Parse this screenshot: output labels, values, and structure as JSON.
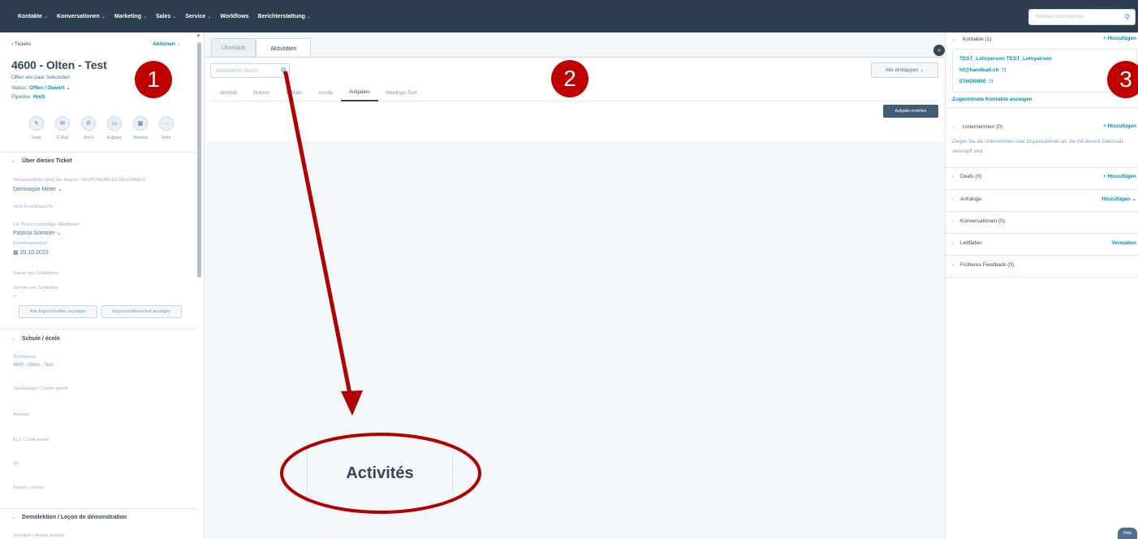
{
  "topnav": {
    "items": [
      "Kontakte",
      "Konversationen",
      "Marketing",
      "Sales",
      "Service",
      "Workflows",
      "Berichterstattung"
    ],
    "search_placeholder": "HubSpot durchsuchen"
  },
  "left": {
    "back_link": "Tickets",
    "actions_label": "Aktionen",
    "ticket_title": "4600 - Olten - Test",
    "opened": "Offen ein paar Sekunden",
    "status_label": "Status:",
    "status_value": "Offen / Ouvert",
    "pipeline_label": "Pipeline:",
    "pipeline_value": "HmS",
    "activity_buttons": [
      "Notiz",
      "E-Mail",
      "Anruf",
      "Aufgabe",
      "Meeting",
      "Mehr"
    ],
    "about_section": "Über dieses Ticket",
    "props": [
      {
        "label": "Verantwortliche HmS der Region / RESPONSABLES RÉGIONAUX",
        "value": "Dominique Meier"
      },
      {
        "label": "HmS-Koordinator*in",
        "value": ""
      },
      {
        "label": "Für Ticket zuständiger Mitarbeiter",
        "value": "Patricia Sommer"
      },
      {
        "label": "Erstellungsdatum",
        "value": "20.10.2023"
      },
      {
        "label": "Datum des Schließens",
        "value": ""
      },
      {
        "label": "Zeit bis zum Schließen",
        "value": "--"
      }
    ],
    "btn_all_props": "Alle Eigenschaften anzeigen",
    "btn_history": "Eigenschaftsverlauf anzeigen",
    "school_section": "Schule / école",
    "school_props": [
      {
        "label": "Ticketname",
        "value": "4600 - Olten - Test"
      },
      {
        "label": "Sportanlage / Centre sportif",
        "value": ""
      },
      {
        "label": "Adresse",
        "value": ""
      },
      {
        "label": "PLZ / Code postal",
        "value": ""
      },
      {
        "label": "Ort",
        "value": ""
      },
      {
        "label": "Kanton / canton",
        "value": ""
      }
    ],
    "demo_section": "Demolektion / Leçon de démonstration",
    "demo_first_label": "Schuljahr / Année scolaire"
  },
  "middle": {
    "tabs": [
      "Überblick",
      "Aktivitäten"
    ],
    "search_placeholder": "Aktivitäten durch",
    "collapse_label": "Alle einklappen",
    "subtabs": [
      "Aktivität",
      "Notizen",
      "E-Mails",
      "Anrufe",
      "Aufgaben",
      "Meetings-Tool"
    ],
    "create_task": "Aufgabe erstellen"
  },
  "right": {
    "contacts_label": "Kontakte (1)",
    "add_label": "+ Hinzufügen",
    "contact_name": "TEST_Lehrperson TEST_Lehrperson",
    "contact_email": "hf@handball.ch",
    "contact_phone": "076000000",
    "associated_link": "Zugeordnete Kontakte anzeigen",
    "companies_label": "Unternehmen (0)",
    "companies_desc": "Zeigen Sie die Unternehmen oder Organisationen an, die mit diesem Datensatz verknüpft sind.",
    "deals_label": "Deals (0)",
    "attachments_label": "Anhänge",
    "attachments_action": "Hinzufügen",
    "conversations_label": "Konversationen (0)",
    "playbooks_label": "Leitfäden",
    "playbooks_action": "Verwalten",
    "feedback_label": "Früheres Feedback (0)"
  },
  "annotations": {
    "badges": [
      "1",
      "2",
      "3"
    ],
    "zoom_text": "Activités",
    "badge_color": "#c00000"
  },
  "chat_label": "Help"
}
